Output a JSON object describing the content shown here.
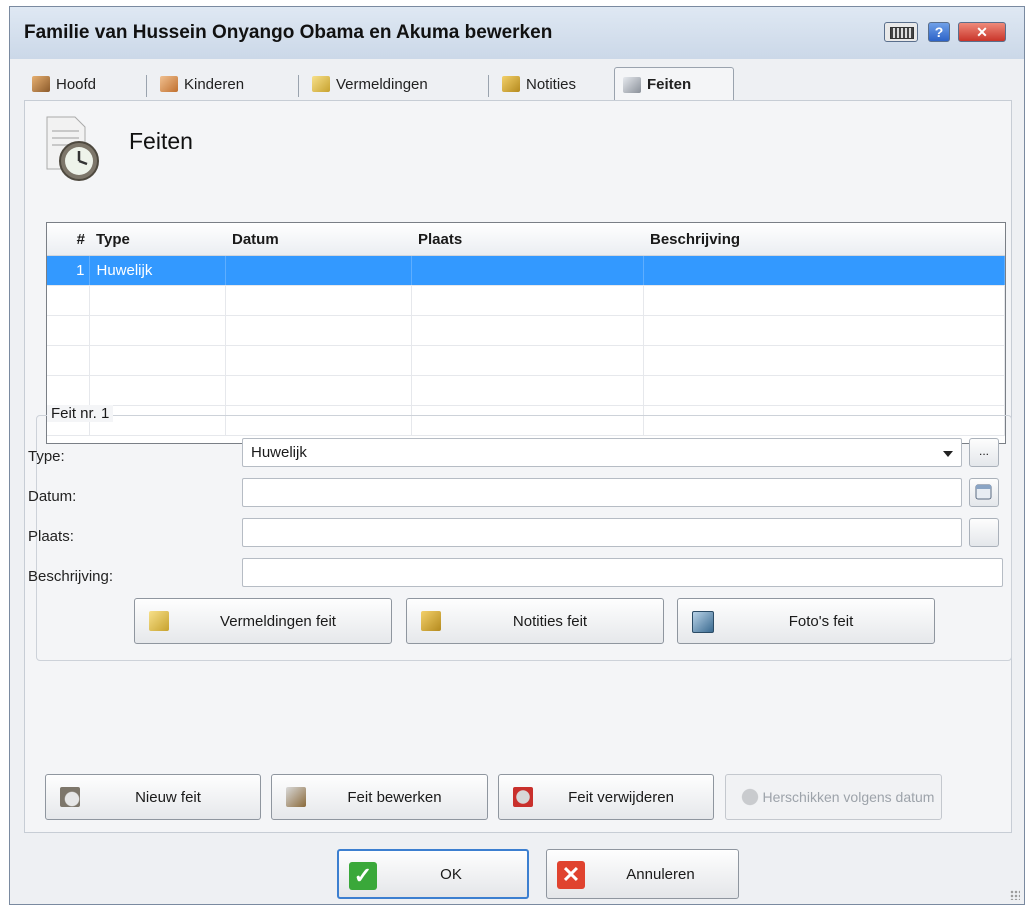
{
  "window": {
    "title": "Familie van Hussein Onyango Obama en Akuma bewerken"
  },
  "tabs": [
    {
      "label": "Hoofd",
      "icon": "people-icon"
    },
    {
      "label": "Kinderen",
      "icon": "children-icon"
    },
    {
      "label": "Vermeldingen",
      "icon": "source-icon"
    },
    {
      "label": "Notities",
      "icon": "notes-icon"
    },
    {
      "label": "Feiten",
      "icon": "facts-icon",
      "active": true
    }
  ],
  "page": {
    "title": "Feiten"
  },
  "table": {
    "columns": [
      "#",
      "Type",
      "Datum",
      "Plaats",
      "Beschrijving"
    ],
    "rows": [
      {
        "num": "1",
        "type": "Huwelijk",
        "datum": "",
        "plaats": "",
        "beschrijving": "",
        "selected": true
      }
    ]
  },
  "detail": {
    "legend": "Feit nr. 1",
    "type_label": "Type:",
    "type_value": "Huwelijk",
    "datum_label": "Datum:",
    "datum_value": "",
    "plaats_label": "Plaats:",
    "plaats_value": "",
    "beschrijving_label": "Beschrijving:",
    "beschrijving_value": "",
    "more_button": "...",
    "buttons": {
      "vermeldingen": "Vermeldingen feit",
      "notities": "Notities feit",
      "fotos": "Foto's feit"
    }
  },
  "actions": {
    "nieuw": "Nieuw feit",
    "bewerken": "Feit bewerken",
    "verwijderen": "Feit verwijderen",
    "herschikken": "Herschikken volgens datum"
  },
  "footer": {
    "ok": "OK",
    "cancel": "Annuleren"
  },
  "colors": {
    "selection": "#3399ff",
    "ok_green": "#3aa83a",
    "cancel_red": "#e0432f"
  }
}
